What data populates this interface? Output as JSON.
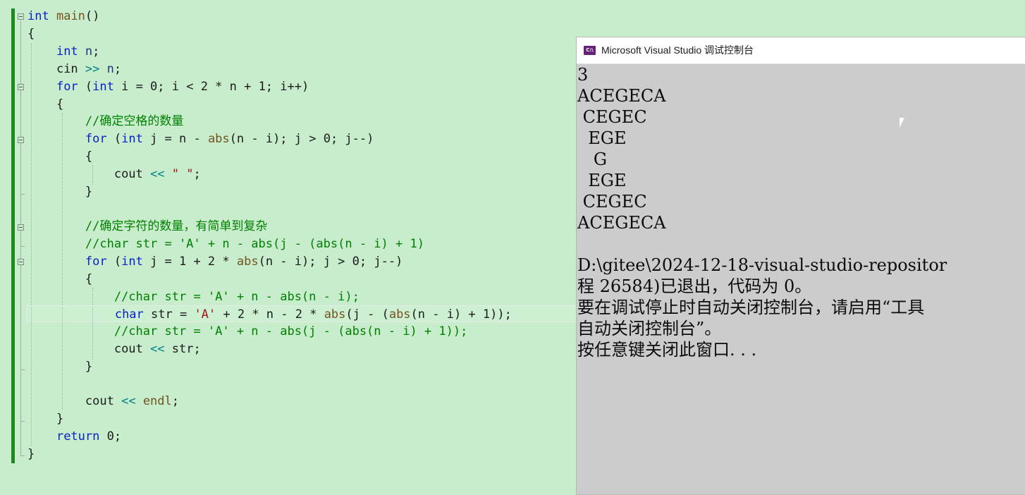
{
  "editor": {
    "code": {
      "l1": {
        "kw": "int",
        "fn": "main",
        "rest": "()"
      },
      "l2": {
        "text": "{"
      },
      "l3": {
        "kw": "int",
        "var": "n",
        "rest": ";"
      },
      "l4": {
        "t1": "cin ",
        "op": ">>",
        "var": "n",
        "rest": ";"
      },
      "l5": {
        "kw1": "for",
        "p1": " (",
        "kw2": "int",
        "t1": " i = 0; i < 2 * n + 1; i++)"
      },
      "l6": {
        "text": "{"
      },
      "l7": {
        "comment": "//确定空格的数量"
      },
      "l8": {
        "kw1": "for",
        "p1": " (",
        "kw2": "int",
        "t1": " j = n - ",
        "fn": "abs",
        "t2": "(n - i); j > 0; j--)"
      },
      "l9": {
        "text": "{"
      },
      "l10": {
        "t1": "cout ",
        "op": "<<",
        "str": "\" \"",
        "rest": ";"
      },
      "l11": {
        "text": "}"
      },
      "l12": {
        "comment": "//确定字符的数量，有简单到复杂"
      },
      "l13": {
        "comment": "//char str = 'A' + n - abs(j - (abs(n - i) + 1)"
      },
      "l14": {
        "kw1": "for",
        "p1": " (",
        "kw2": "int",
        "t1": " j = 1 + 2 * ",
        "fn": "abs",
        "t2": "(n - i); j > 0; j--)"
      },
      "l15": {
        "text": "{"
      },
      "l16": {
        "comment": "//char str = 'A' + n - abs(n - i);"
      },
      "l17": {
        "kw": "char",
        "t1": " str = ",
        "str": "'A'",
        "t2": " + 2 * n - 2 * ",
        "fn1": "abs",
        "t3": "(j - (",
        "fn2": "abs",
        "t4": "(n - i) + 1));"
      },
      "l18": {
        "comment": "//char str = 'A' + n - abs(j - (abs(n - i) + 1));"
      },
      "l19": {
        "t1": "cout ",
        "op": "<<",
        "t2": " str;"
      },
      "l20": {
        "text": "}"
      },
      "l21": {
        "t1": "cout ",
        "op": "<<",
        "fn": "endl",
        "rest": ";"
      },
      "l22": {
        "text": "}"
      },
      "l23": {
        "kw": "return",
        "rest": " 0;"
      },
      "l24": {
        "text": "}"
      }
    }
  },
  "console": {
    "title": "Microsoft Visual Studio 调试控制台",
    "icon_label": "C:\\",
    "icon": "vs-console-icon",
    "output": [
      "3",
      "ACEGECA",
      " CEGEC",
      "  EGE",
      "   G",
      "  EGE",
      " CEGEC",
      "ACEGECA",
      "",
      "D:\\gitee\\2024-12-18-visual-studio-repositor",
      "程 26584)已退出，代码为 0。",
      "要在调试停止时自动关闭控制台，请启用“工具",
      "自动关闭控制台”。",
      "按任意键关闭此窗口. . ."
    ]
  },
  "colors": {
    "editor_bg": "#c7edcc",
    "keyword": "#0b21c7",
    "function": "#74531f",
    "string": "#a31515",
    "operator": "#008080",
    "comment": "#008000",
    "variable": "#1f377f",
    "console_bg": "#cccccc"
  }
}
